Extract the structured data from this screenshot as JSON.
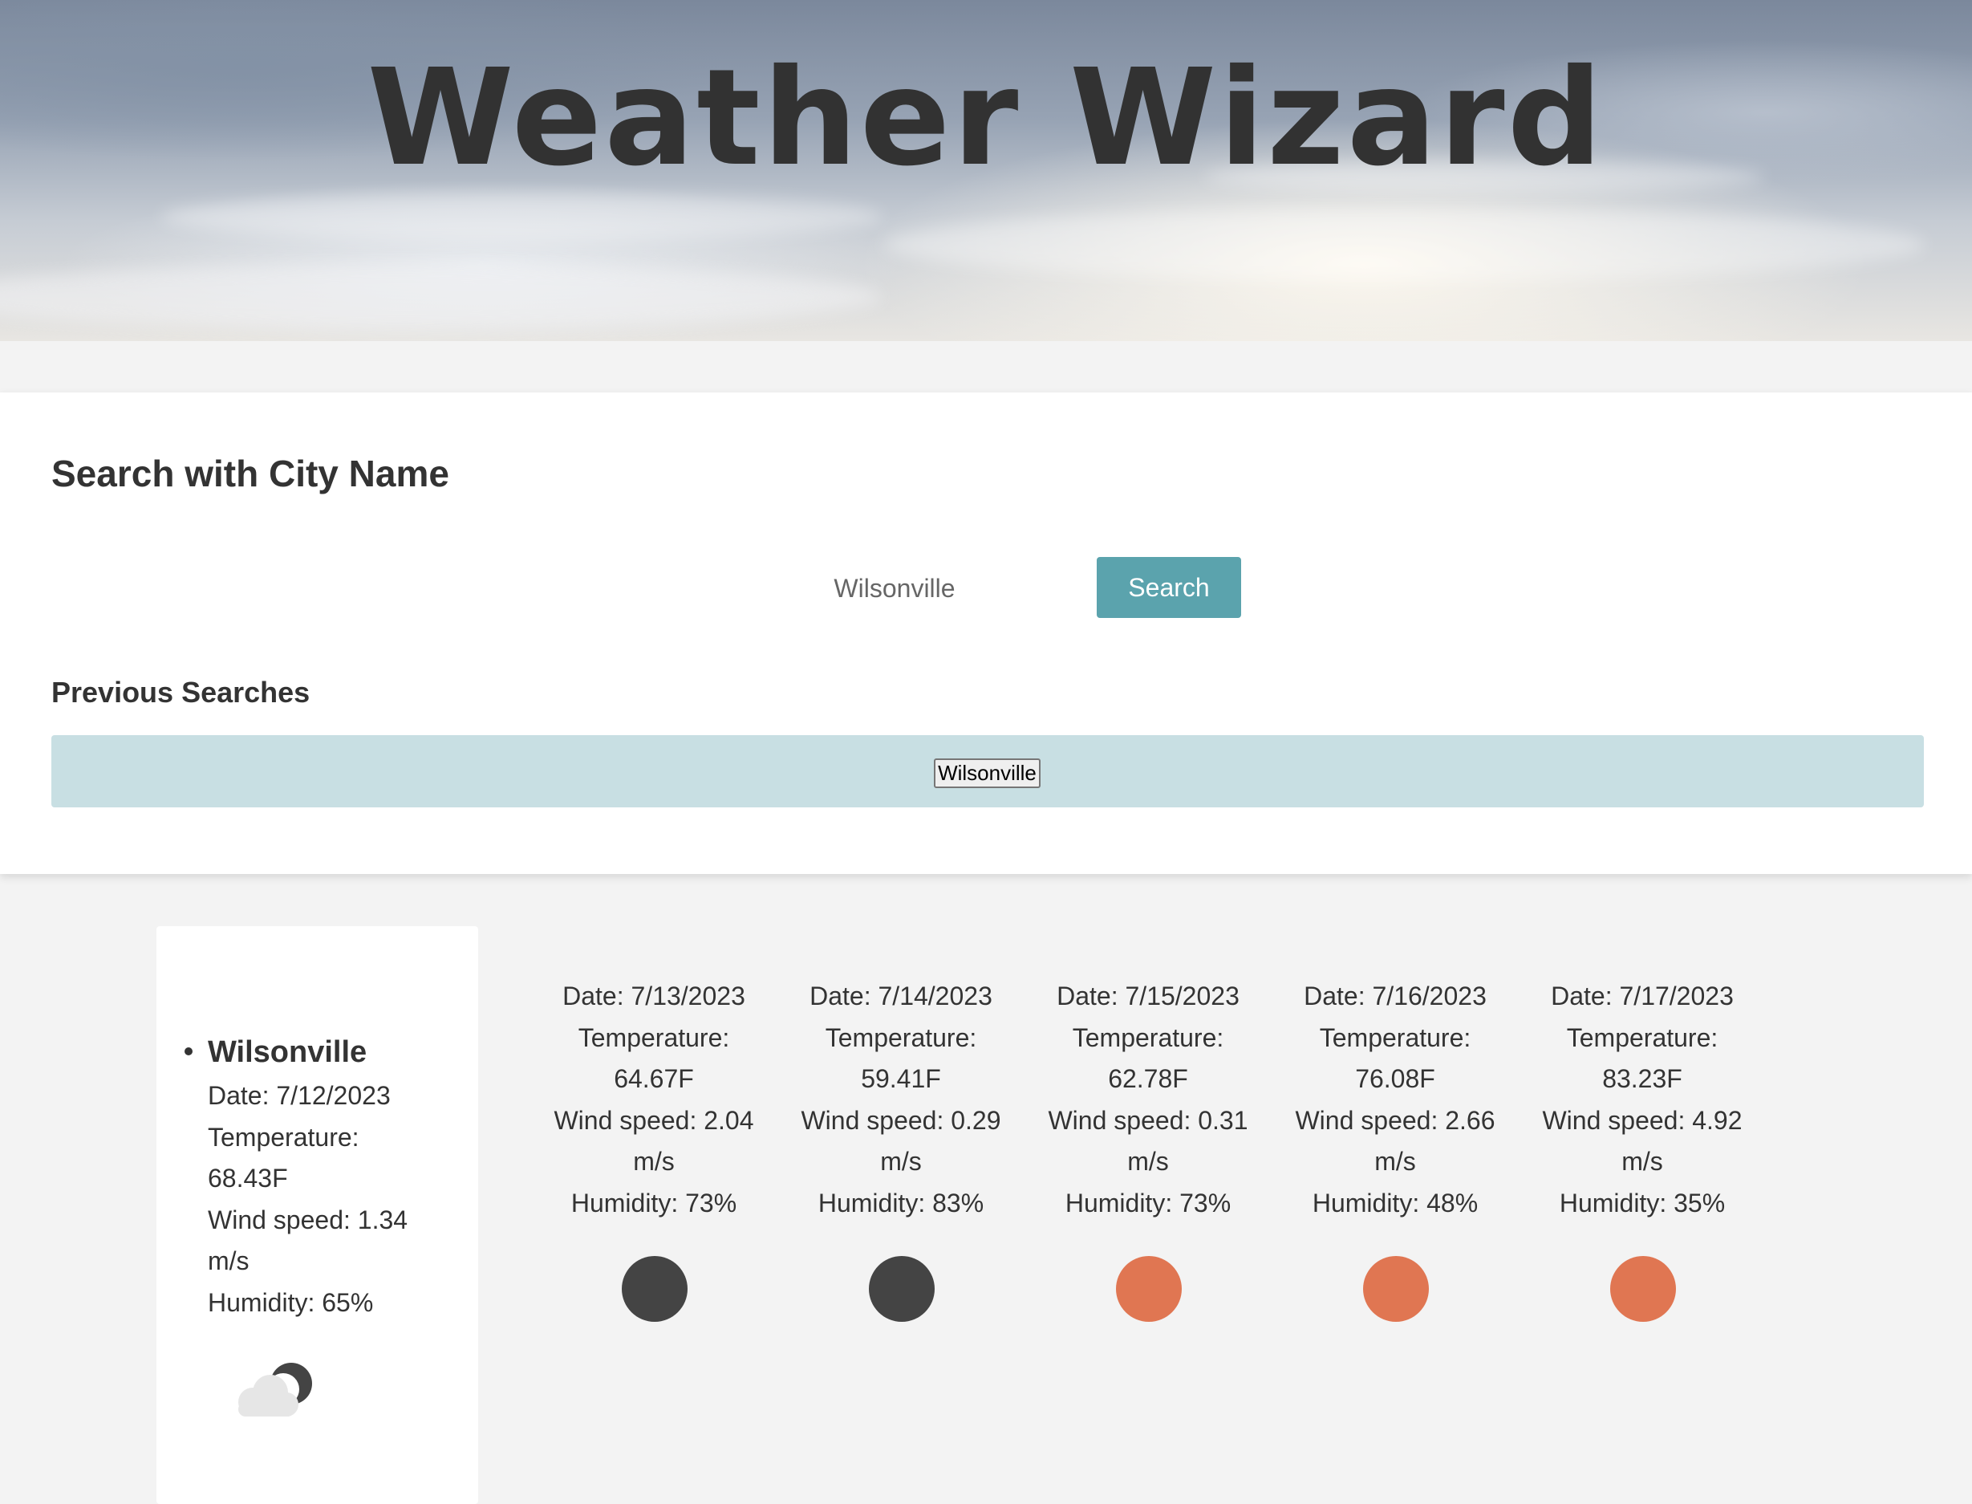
{
  "header": {
    "title": "Weather Wizard"
  },
  "search": {
    "heading": "Search with City Name",
    "input_value": "Wilsonville",
    "button_label": "Search"
  },
  "previous": {
    "heading": "Previous Searches",
    "items": [
      "Wilsonville"
    ]
  },
  "current": {
    "city": "Wilsonville",
    "date": "Date: 7/12/2023",
    "temp_label": "Temperature:",
    "temp_value": "68.43F",
    "wind_label": "Wind speed: 1.34",
    "wind_unit": "m/s",
    "humidity": "Humidity: 65%",
    "icon": "partly-cloudy-night-icon"
  },
  "forecast": [
    {
      "date": "Date: 7/13/2023",
      "temp_label": "Temperature:",
      "temp_value": "64.67F",
      "wind_label": "Wind speed: 2.04",
      "wind_unit": "m/s",
      "humidity": "Humidity: 73%",
      "icon": "dark-circle-icon",
      "color": "#444444"
    },
    {
      "date": "Date: 7/14/2023",
      "temp_label": "Temperature:",
      "temp_value": "59.41F",
      "wind_label": "Wind speed: 0.29",
      "wind_unit": "m/s",
      "humidity": "Humidity: 83%",
      "icon": "dark-circle-icon",
      "color": "#444444"
    },
    {
      "date": "Date: 7/15/2023",
      "temp_label": "Temperature:",
      "temp_value": "62.78F",
      "wind_label": "Wind speed: 0.31",
      "wind_unit": "m/s",
      "humidity": "Humidity: 73%",
      "icon": "sun-icon",
      "color": "#e07652"
    },
    {
      "date": "Date: 7/16/2023",
      "temp_label": "Temperature:",
      "temp_value": "76.08F",
      "wind_label": "Wind speed: 2.66",
      "wind_unit": "m/s",
      "humidity": "Humidity: 48%",
      "icon": "sun-icon",
      "color": "#e07652"
    },
    {
      "date": "Date: 7/17/2023",
      "temp_label": "Temperature:",
      "temp_value": "83.23F",
      "wind_label": "Wind speed: 4.92",
      "wind_unit": "m/s",
      "humidity": "Humidity: 35%",
      "icon": "sun-icon",
      "color": "#e07652"
    }
  ],
  "colors": {
    "accent": "#5ba3ad",
    "previous_bar": "#c8dfe3",
    "page_background": "#f3f3f3",
    "title_text": "#323232"
  }
}
